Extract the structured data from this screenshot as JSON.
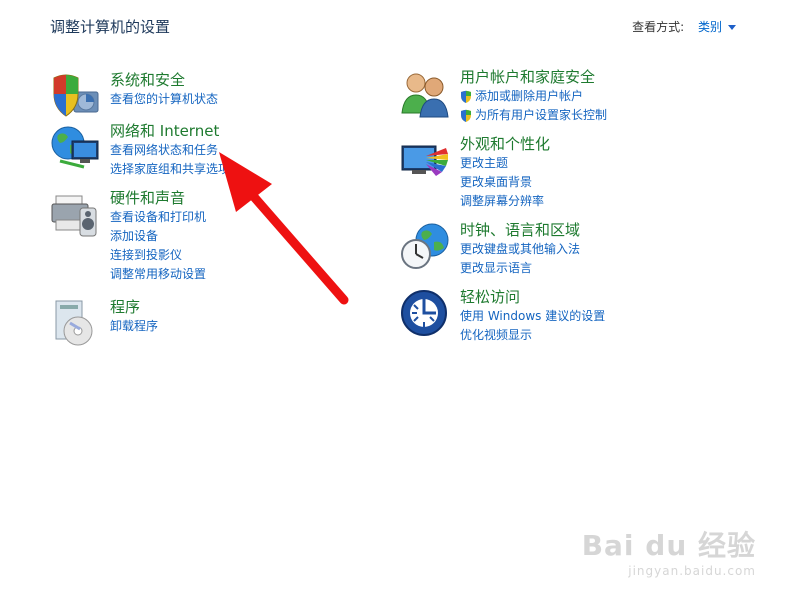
{
  "header": {
    "title": "调整计算机的设置",
    "view_by_label": "查看方式:",
    "view_by_value": "类别"
  },
  "categories": [
    {
      "title": "系统和安全",
      "icon": "shield-computer-icon",
      "links": [
        {
          "label": "查看您的计算机状态"
        }
      ]
    },
    {
      "title": "网络和 Internet",
      "icon": "network-globe-icon",
      "links": [
        {
          "label": "查看网络状态和任务"
        },
        {
          "label": "选择家庭组和共享选项"
        }
      ]
    },
    {
      "title": "硬件和声音",
      "icon": "printer-speaker-icon",
      "links": [
        {
          "label": "查看设备和打印机"
        },
        {
          "label": "添加设备"
        },
        {
          "label": "连接到投影仪"
        },
        {
          "label": "调整常用移动设置"
        }
      ]
    },
    {
      "title": "程序",
      "icon": "programs-disc-icon",
      "links": [
        {
          "label": "卸载程序"
        }
      ]
    },
    {
      "title": "用户帐户和家庭安全",
      "icon": "users-icon",
      "links": [
        {
          "label": "添加或删除用户帐户",
          "shield": true
        },
        {
          "label": "为所有用户设置家长控制",
          "shield": true
        }
      ]
    },
    {
      "title": "外观和个性化",
      "icon": "monitor-palette-icon",
      "links": [
        {
          "label": "更改主题"
        },
        {
          "label": "更改桌面背景"
        },
        {
          "label": "调整屏幕分辨率"
        }
      ]
    },
    {
      "title": "时钟、语言和区域",
      "icon": "clock-globe-icon",
      "links": [
        {
          "label": "更改键盘或其他输入法"
        },
        {
          "label": "更改显示语言"
        }
      ]
    },
    {
      "title": "轻松访问",
      "icon": "ease-of-access-icon",
      "links": [
        {
          "label": "使用 Windows 建议的设置"
        },
        {
          "label": "优化视频显示"
        }
      ]
    }
  ],
  "annotation": {
    "arrow_color": "#ee1111"
  },
  "watermark": {
    "brand": "Bai du 经验",
    "url": "jingyan.baidu.com"
  }
}
